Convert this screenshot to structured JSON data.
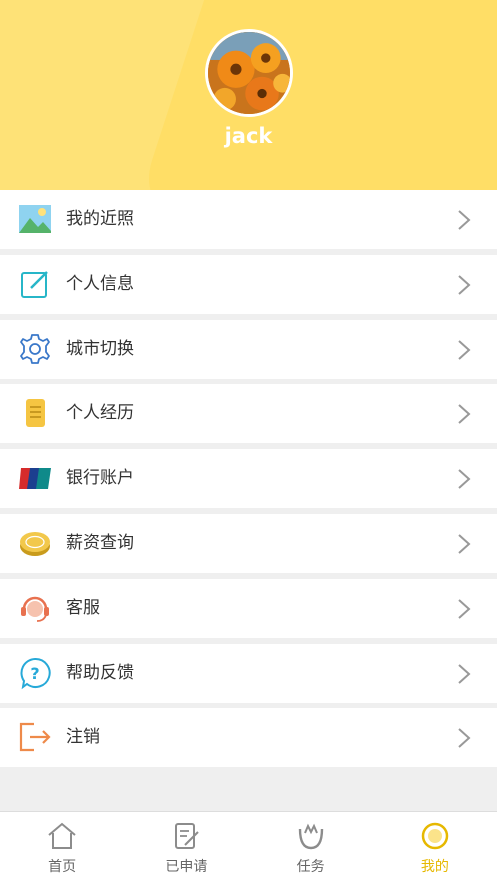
{
  "profile": {
    "username": "jack"
  },
  "menu": {
    "items": [
      {
        "label": "我的近照",
        "icon": "landscape-photo-icon"
      },
      {
        "label": "个人信息",
        "icon": "edit-note-icon"
      },
      {
        "label": "城市切换",
        "icon": "gear-icon"
      },
      {
        "label": "个人经历",
        "icon": "document-icon"
      },
      {
        "label": "银行账户",
        "icon": "unionpay-card-icon"
      },
      {
        "label": "薪资查询",
        "icon": "coin-icon"
      },
      {
        "label": "客服",
        "icon": "headset-icon"
      },
      {
        "label": "帮助反馈",
        "icon": "help-bubble-icon"
      },
      {
        "label": "注销",
        "icon": "logout-icon"
      }
    ]
  },
  "tabbar": {
    "tabs": [
      {
        "label": "首页",
        "icon": "home-icon"
      },
      {
        "label": "已申请",
        "icon": "applied-icon"
      },
      {
        "label": "任务",
        "icon": "task-icon"
      },
      {
        "label": "我的",
        "icon": "profile-icon",
        "active": true
      }
    ]
  },
  "colors": {
    "header_bg": "#fee277",
    "accent": "#e6b800",
    "page_bg": "#efefef"
  }
}
